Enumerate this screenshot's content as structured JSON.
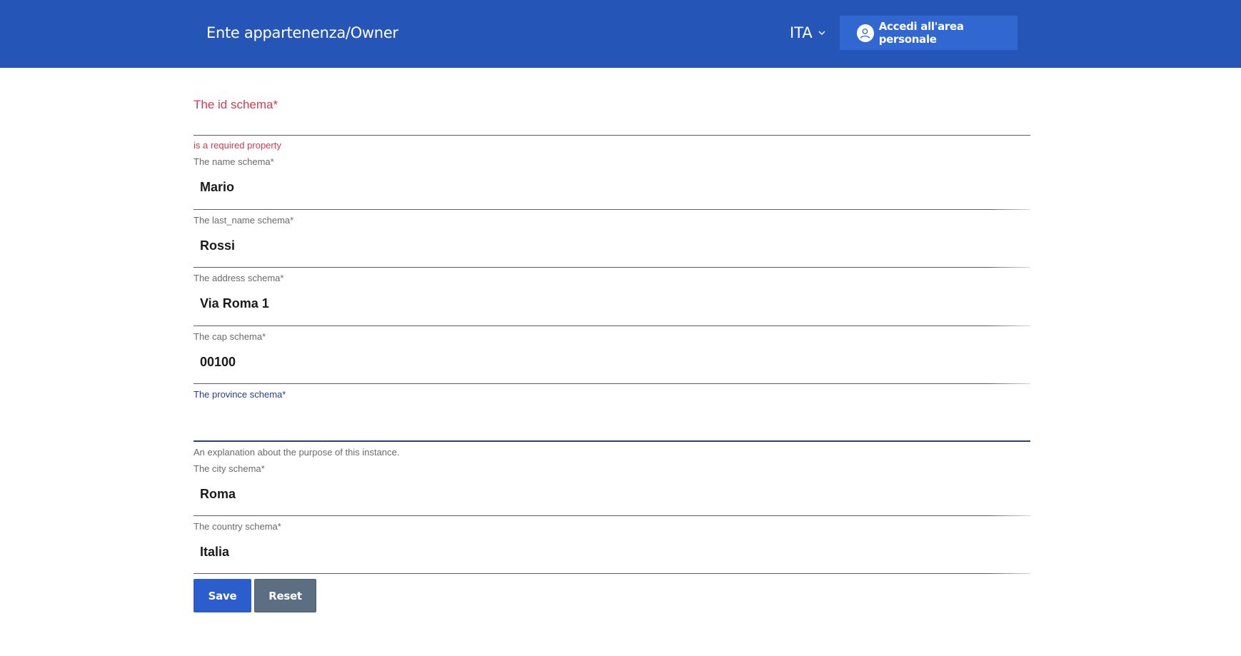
{
  "header": {
    "title": "Ente appartenenza/Owner",
    "language": "ITA",
    "login_label": "Accedi all'area personale"
  },
  "form": {
    "id_field": {
      "label": "The id schema*",
      "value": "",
      "error": "is a required property"
    },
    "fields": [
      {
        "label": "The name schema*",
        "value": "Mario"
      },
      {
        "label": "The last_name schema*",
        "value": "Rossi"
      },
      {
        "label": "The address schema*",
        "value": "Via Roma 1"
      },
      {
        "label": "The cap schema*",
        "value": "00100"
      }
    ],
    "province_field": {
      "label": "The province schema*",
      "value": "",
      "helper": "An explanation about the purpose of this instance."
    },
    "fields_after": [
      {
        "label": "The city schema*",
        "value": "Roma"
      },
      {
        "label": "The country schema*",
        "value": "Italia"
      }
    ],
    "save_label": "Save",
    "reset_label": "Reset"
  },
  "colors": {
    "header_bg": "#2556b7",
    "login_btn_bg": "#3067d1",
    "error": "#d9364f",
    "focus": "#2a3a9c",
    "save_bg": "#2c5dcd",
    "reset_bg": "#5c6f82"
  }
}
